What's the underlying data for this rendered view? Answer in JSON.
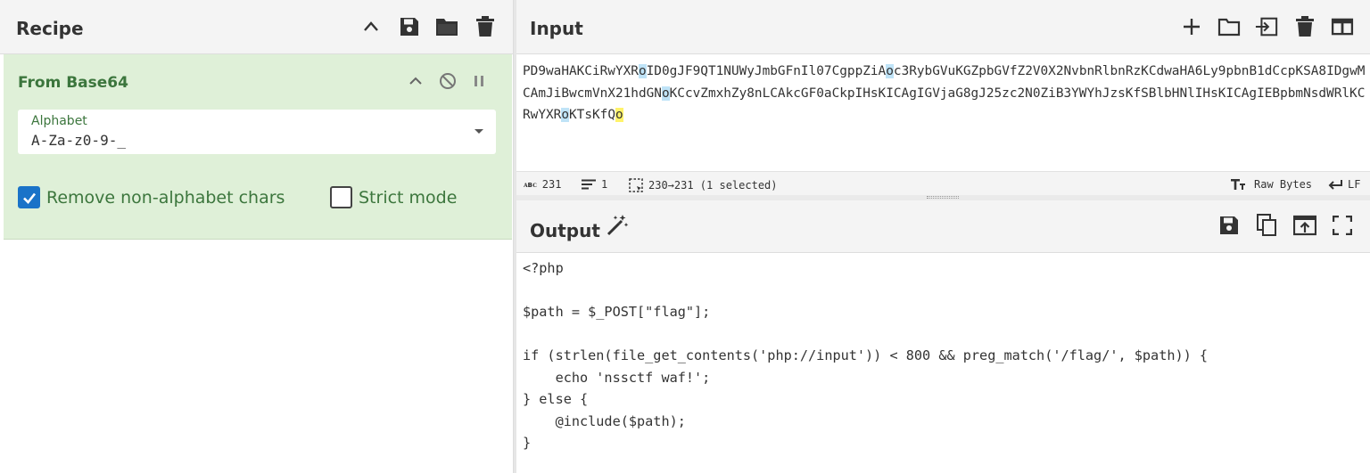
{
  "recipe": {
    "title": "Recipe",
    "icons": [
      "chevron-up-icon",
      "save-icon",
      "folder-icon",
      "trash-icon"
    ],
    "operation": {
      "name": "From Base64",
      "alphabet_label": "Alphabet",
      "alphabet_value": "A-Za-z0-9-_",
      "remove_non_alphabet_label": "Remove non-alphabet chars",
      "remove_non_alphabet_checked": true,
      "strict_mode_label": "Strict mode",
      "strict_mode_checked": false
    }
  },
  "input": {
    "title": "Input",
    "icons": [
      "plus-icon",
      "folder-icon",
      "import-icon",
      "trash-icon",
      "layout-icon"
    ],
    "segments": [
      {
        "text": "PD9waHAKCiRwYXR",
        "hl": ""
      },
      {
        "text": "o",
        "hl": "blue"
      },
      {
        "text": "ID0gJF9QT1NUWyJmbGFnIl07CgppZiA",
        "hl": ""
      },
      {
        "text": "o",
        "hl": "blue"
      },
      {
        "text": "c3RybGVuKGZpbGVfZ2V0X2NvbnRlbnRzKCdwaHA6Ly9pbnB1dCcpKSA8IDgwMCAmJiBwcmVnX21hdGN",
        "hl": ""
      },
      {
        "text": "o",
        "hl": "blue"
      },
      {
        "text": "KCcvZmxhZy8nLCAkcGF0aCkpIHsKICAgIGVjaG8gJ25zc2N0ZiB3YWYhJzsKfSBlbHNlIHsKICAgIEBpbmNsdWRlKCRwYXR",
        "hl": ""
      },
      {
        "text": "o",
        "hl": "blue"
      },
      {
        "text": "KTsKfQ",
        "hl": ""
      },
      {
        "text": "o",
        "hl": "yellow"
      }
    ],
    "status": {
      "length": "231",
      "lines": "1",
      "selection": "230→231 (1 selected)",
      "encoding": "Raw Bytes",
      "eol": "LF"
    }
  },
  "output": {
    "title": "Output",
    "icons": [
      "magic-wand-icon",
      "save-icon",
      "copy-icon",
      "open-in-input-icon",
      "fullscreen-icon"
    ],
    "lines": [
      "<?php",
      "",
      "$path = $_POST[\"flag\"];",
      "",
      "if (strlen(file_get_contents('php://input')) < 800 && preg_match('/flag/', $path)) {",
      "    echo 'nssctf waf!';",
      "} else {",
      "    @include($path);",
      "}"
    ]
  }
}
